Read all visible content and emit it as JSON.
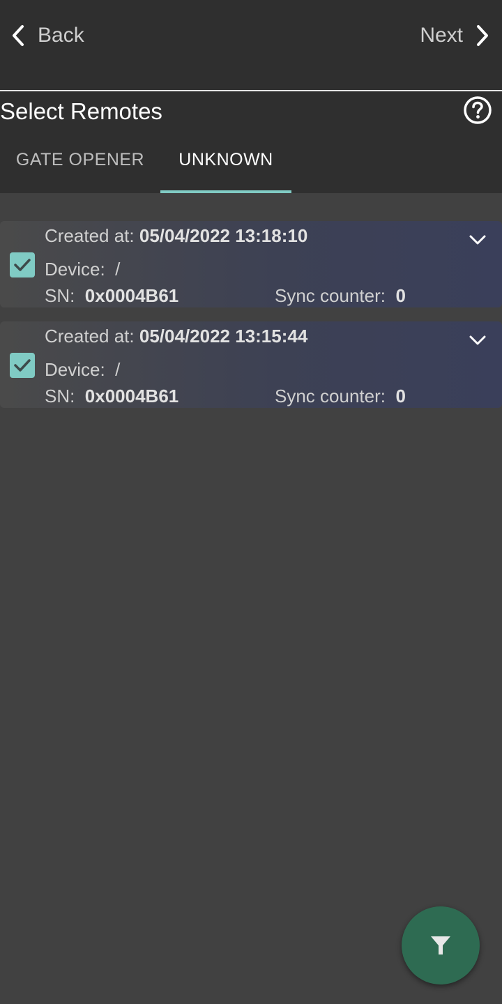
{
  "nav": {
    "back_label": "Back",
    "next_label": "Next"
  },
  "header": {
    "title": "Select Remotes",
    "help_icon": "help-circle-icon"
  },
  "tabs": [
    {
      "label": "GATE OPENER",
      "selected": false
    },
    {
      "label": "UNKNOWN",
      "selected": true
    }
  ],
  "remotes": [
    {
      "created_label": "Created at:",
      "created_value": "05/04/2022 13:18:10",
      "device_label": "Device:",
      "device_value": "/",
      "sn_label": "SN:",
      "sn_value": "0x0004B61",
      "sync_label": "Sync counter:",
      "sync_value": "0",
      "checked": true
    },
    {
      "created_label": "Created at:",
      "created_value": "05/04/2022 13:15:44",
      "device_label": "Device:",
      "device_value": "/",
      "sn_label": "SN:",
      "sn_value": "0x0004B61",
      "sync_label": "Sync counter:",
      "sync_value": "0",
      "checked": true
    }
  ],
  "fab": {
    "icon": "filter-icon"
  },
  "colors": {
    "accent": "#80cbc4",
    "fab": "#2e6b52",
    "background": "#414141",
    "header": "#2f2f2f"
  }
}
